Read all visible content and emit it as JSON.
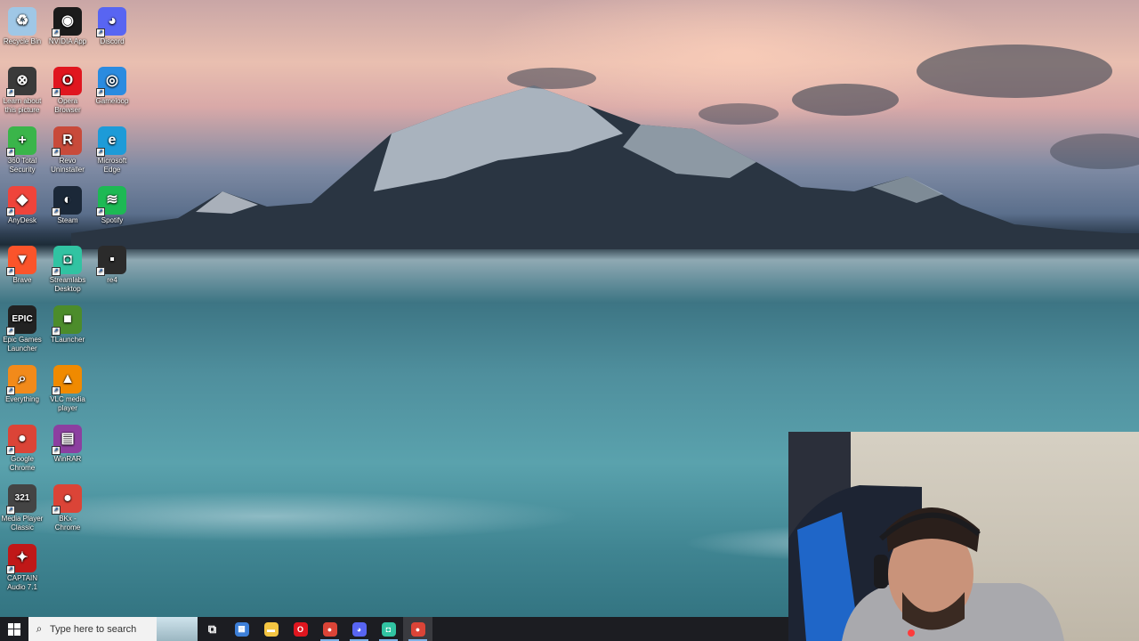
{
  "desktop_icons": [
    {
      "label": "Recycle Bin",
      "icon": "recycle-bin-icon",
      "color": "#9fc7e6",
      "glyph": "♻"
    },
    {
      "label": "NVIDIA App",
      "icon": "nvidia-icon",
      "color": "#1b1b1b",
      "glyph": "◉"
    },
    {
      "label": "Discord",
      "icon": "discord-icon",
      "color": "#5865f2",
      "glyph": "◕"
    },
    {
      "label": "Learn about this picture",
      "icon": "learn-picture-icon",
      "color": "#3a3a3a",
      "glyph": "⊗"
    },
    {
      "label": "Opera Browser",
      "icon": "opera-icon",
      "color": "#e0161f",
      "glyph": "O"
    },
    {
      "label": "Gameloop",
      "icon": "gameloop-icon",
      "color": "#2a8be0",
      "glyph": "◎"
    },
    {
      "label": "360 Total Security",
      "icon": "360-security-icon",
      "color": "#3ab54a",
      "glyph": "+"
    },
    {
      "label": "Revo Uninstaller",
      "icon": "revo-uninstaller-icon",
      "color": "#c84a3a",
      "glyph": "R"
    },
    {
      "label": "Microsoft Edge",
      "icon": "edge-icon",
      "color": "#1d9bd8",
      "glyph": "e"
    },
    {
      "label": "AnyDesk",
      "icon": "anydesk-icon",
      "color": "#ef443b",
      "glyph": "◆"
    },
    {
      "label": "Steam",
      "icon": "steam-icon",
      "color": "#1b2838",
      "glyph": "◐"
    },
    {
      "label": "Spotify",
      "icon": "spotify-icon",
      "color": "#1db954",
      "glyph": "≋"
    },
    {
      "label": "Brave",
      "icon": "brave-icon",
      "color": "#fb542b",
      "glyph": "▼"
    },
    {
      "label": "Streamlabs Desktop",
      "icon": "streamlabs-icon",
      "color": "#31c3a2",
      "glyph": "◘"
    },
    {
      "label": "re4",
      "icon": "re4-icon",
      "color": "#2b2b2b",
      "glyph": "▪"
    },
    {
      "label": "Epic Games Launcher",
      "icon": "epic-games-icon",
      "color": "#222222",
      "glyph": "EPIC"
    },
    {
      "label": "TLauncher",
      "icon": "tlauncher-icon",
      "color": "#4c8c2b",
      "glyph": "■"
    },
    {
      "label": "",
      "icon": "blank",
      "color": "",
      "glyph": ""
    },
    {
      "label": "Everything",
      "icon": "everything-icon",
      "color": "#f28a1a",
      "glyph": "⌕"
    },
    {
      "label": "VLC media player",
      "icon": "vlc-icon",
      "color": "#f08a00",
      "glyph": "▲"
    },
    {
      "label": "",
      "icon": "blank",
      "color": "",
      "glyph": ""
    },
    {
      "label": "Google Chrome",
      "icon": "chrome-icon",
      "color": "#db4437",
      "glyph": "●"
    },
    {
      "label": "WinRAR",
      "icon": "winrar-icon",
      "color": "#8c3fa0",
      "glyph": "▤"
    },
    {
      "label": "",
      "icon": "blank",
      "color": "",
      "glyph": ""
    },
    {
      "label": "Media Player Classic",
      "icon": "media-player-classic-icon",
      "color": "#444444",
      "glyph": "321"
    },
    {
      "label": "BKx - Chrome",
      "icon": "chrome-profile-icon",
      "color": "#db4437",
      "glyph": "●"
    },
    {
      "label": "",
      "icon": "blank",
      "color": "",
      "glyph": ""
    },
    {
      "label": "CAPTAIN Audio 7.1",
      "icon": "captain-audio-icon",
      "color": "#c01818",
      "glyph": "✦"
    }
  ],
  "taskbar": {
    "search_placeholder": "Type here to search",
    "pinned": [
      {
        "name": "task-view",
        "icon": "task-view-icon",
        "color": "#1c1d22",
        "glyph": "⧉",
        "running": false
      },
      {
        "name": "microsoft-store",
        "icon": "store-icon",
        "color": "#3d7fd8",
        "glyph": "▦",
        "running": false
      },
      {
        "name": "file-explorer",
        "icon": "folder-icon",
        "color": "#f4c542",
        "glyph": "▬",
        "running": false
      },
      {
        "name": "opera",
        "icon": "opera-icon",
        "color": "#e0161f",
        "glyph": "O",
        "running": false
      },
      {
        "name": "chrome",
        "icon": "chrome-icon",
        "color": "#db4437",
        "glyph": "●",
        "running": true
      },
      {
        "name": "discord",
        "icon": "discord-icon",
        "color": "#5865f2",
        "glyph": "◕",
        "running": true
      },
      {
        "name": "streamlabs",
        "icon": "streamlabs-icon",
        "color": "#31c3a2",
        "glyph": "◘",
        "running": true
      },
      {
        "name": "chrome-profile",
        "icon": "chrome-icon",
        "color": "#db4437",
        "glyph": "●",
        "running": true,
        "active": true
      }
    ]
  }
}
